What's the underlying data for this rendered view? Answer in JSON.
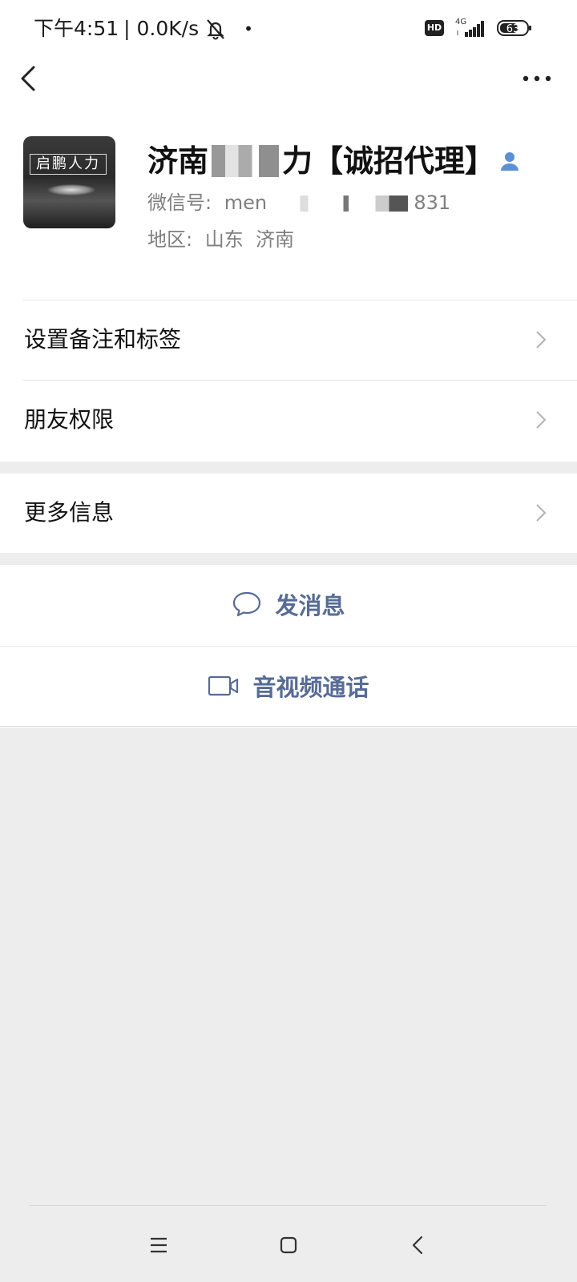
{
  "status_bar": {
    "time": "下午4:51",
    "net_speed": "| 0.0K/s",
    "hd": "HD",
    "network": "4G",
    "battery": "63"
  },
  "profile": {
    "name_prefix": "济南",
    "name_suffix": "力【诚招代理】",
    "wechat_id_label": "微信号:",
    "wechat_id_prefix": "men",
    "wechat_id_suffix": "831",
    "region_label": "地区:",
    "region_value": "山东  济南"
  },
  "menu": {
    "remark_tags": "设置备注和标签",
    "friend_permissions": "朋友权限",
    "more_info": "更多信息"
  },
  "actions": {
    "send_message": "发消息",
    "video_call": "音视频通话"
  },
  "avatar": {
    "title": "启鹏人力"
  },
  "colors": {
    "link_blue": "#576b95",
    "background": "#ededed",
    "verified": "#5b8fd6"
  }
}
